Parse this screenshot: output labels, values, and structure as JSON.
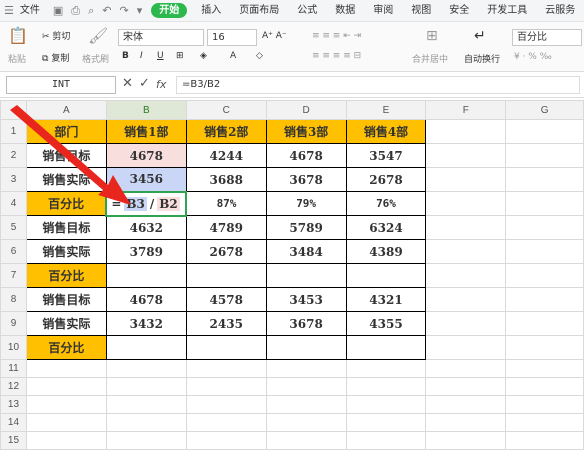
{
  "menu": {
    "file": "文件",
    "tabs": [
      "开始",
      "插入",
      "页面布局",
      "公式",
      "数据",
      "审阅",
      "视图",
      "安全",
      "开发工具",
      "云服务"
    ]
  },
  "ribbon": {
    "cut": "剪切",
    "copy": "复制",
    "paste": "粘贴",
    "format_painter": "格式刷",
    "font_name": "宋体",
    "font_size": "16",
    "merge": "合并居中",
    "wrap": "自动换行",
    "number_format": "百分比"
  },
  "formula": {
    "name_box": "INT",
    "fx": "fx",
    "text": "=B3/B2"
  },
  "sheet": {
    "columns": [
      "A",
      "B",
      "C",
      "D",
      "E",
      "F",
      "G"
    ],
    "rows": [
      {
        "n": "1",
        "cells": [
          "部门",
          "销售1部",
          "销售2部",
          "销售3部",
          "销售4部",
          "",
          ""
        ]
      },
      {
        "n": "2",
        "cells": [
          "销售目标",
          "4678",
          "4244",
          "4678",
          "3547",
          "",
          ""
        ]
      },
      {
        "n": "3",
        "cells": [
          "销售实际",
          "3456",
          "3688",
          "3678",
          "2678",
          "",
          ""
        ]
      },
      {
        "n": "4",
        "cells": [
          "百分比",
          "",
          "87%",
          "79%",
          "76%",
          "",
          ""
        ]
      },
      {
        "n": "5",
        "cells": [
          "销售目标",
          "4632",
          "4789",
          "5789",
          "6324",
          "",
          ""
        ]
      },
      {
        "n": "6",
        "cells": [
          "销售实际",
          "3789",
          "2678",
          "3484",
          "4389",
          "",
          ""
        ]
      },
      {
        "n": "7",
        "cells": [
          "百分比",
          "",
          "",
          "",
          "",
          "",
          ""
        ]
      },
      {
        "n": "8",
        "cells": [
          "销售目标",
          "4678",
          "4578",
          "3453",
          "4321",
          "",
          ""
        ]
      },
      {
        "n": "9",
        "cells": [
          "销售实际",
          "3432",
          "2435",
          "3678",
          "4355",
          "",
          ""
        ]
      },
      {
        "n": "10",
        "cells": [
          "百分比",
          "",
          "",
          "",
          "",
          "",
          ""
        ]
      },
      {
        "n": "11",
        "cells": [
          "",
          "",
          "",
          "",
          "",
          "",
          ""
        ]
      },
      {
        "n": "12",
        "cells": [
          "",
          "",
          "",
          "",
          "",
          "",
          ""
        ]
      },
      {
        "n": "13",
        "cells": [
          "",
          "",
          "",
          "",
          "",
          "",
          ""
        ]
      },
      {
        "n": "14",
        "cells": [
          "",
          "",
          "",
          "",
          "",
          "",
          ""
        ]
      },
      {
        "n": "15",
        "cells": [
          "",
          "",
          "",
          "",
          "",
          "",
          ""
        ]
      }
    ],
    "editing": {
      "eq": "=",
      "ref1": "B3",
      "slash": "/",
      "ref2": "B2"
    }
  }
}
